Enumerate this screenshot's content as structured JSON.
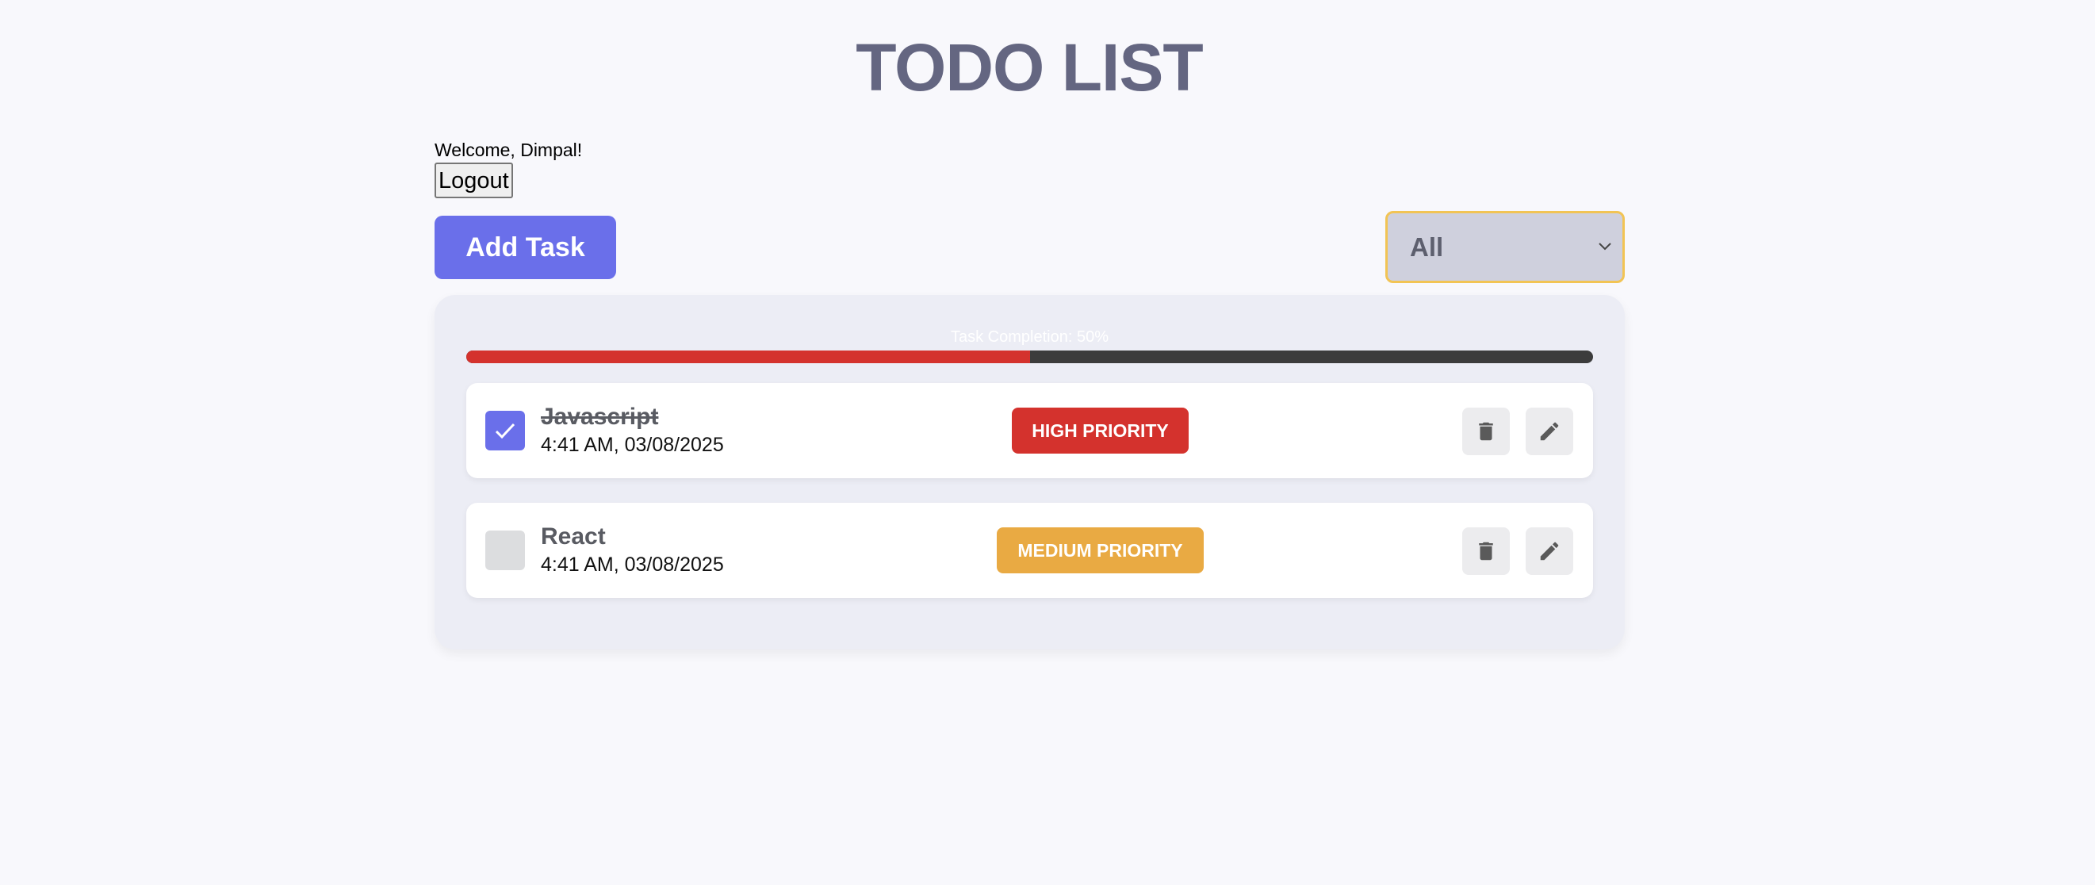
{
  "header": {
    "title": "TODO LIST"
  },
  "user": {
    "welcome": "Welcome, Dimpal!",
    "logout_label": "Logout"
  },
  "toolbar": {
    "add_task_label": "Add Task",
    "filter": {
      "selected": "All"
    }
  },
  "progress": {
    "label": "Task Completion: 50%",
    "value": 0.5
  },
  "tasks": [
    {
      "name": "Javascript",
      "time": "4:41 AM, 03/08/2025",
      "completed": true,
      "priority": "HIGH PRIORITY"
    },
    {
      "name": "React",
      "time": "4:41 AM, 03/08/2025",
      "completed": false,
      "priority": "MEDIUM PRIORITY"
    }
  ],
  "colors": {
    "accent": "#6a6fea",
    "high_priority": "#d4322d",
    "medium_priority": "#e9aa43",
    "filter_border": "#f2c454"
  },
  "icons": {
    "delete": "trash-icon",
    "edit": "pencil-icon",
    "checked": "check-icon",
    "select": "chevron-down-icon"
  }
}
